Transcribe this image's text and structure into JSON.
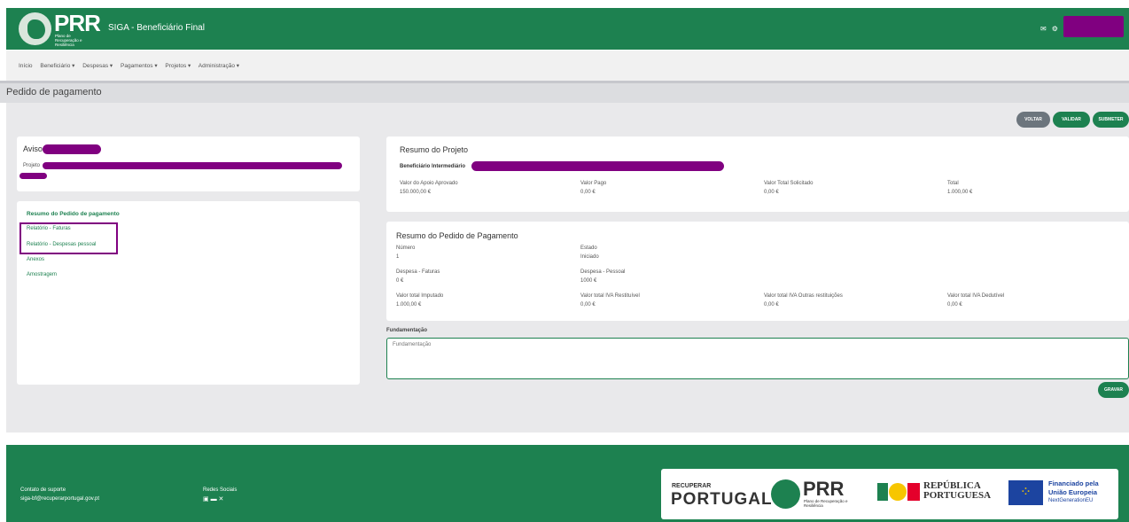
{
  "header": {
    "logo_text": "PRR",
    "logo_subtitle": "Plano de Recuperação e Resiliência",
    "app_title": "SIGA - Beneficiário Final"
  },
  "nav": {
    "items": [
      "Início",
      "Beneficiário ▾",
      "Despesas ▾",
      "Pagamentos ▾",
      "Projetos ▾",
      "Administração ▾"
    ]
  },
  "page": {
    "title": "Pedido de pagamento",
    "buttons": {
      "voltar": "VOLTAR",
      "validar": "VALIDAR",
      "submeter": "SUBMETER",
      "gravar": "GRAVAR"
    }
  },
  "aviso_card": {
    "title": "Aviso",
    "projeto_label": "Projeto"
  },
  "sidebar": {
    "title": "Resumo do Pedido de pagamento",
    "items": [
      "Relatório - Faturas",
      "Relatório - Despesas pessoal",
      "Anexos",
      "Amostragem"
    ]
  },
  "resumo_projeto": {
    "title": "Resumo do Projeto",
    "beneficiario_label": "Beneficiário Intermediário",
    "fields": [
      {
        "label": "Valor do Apoio Aprovado",
        "value": "150.000,00 €"
      },
      {
        "label": "Valor Pago",
        "value": "0,00 €"
      },
      {
        "label": "Valor Total Solicitado",
        "value": "0,00 €"
      },
      {
        "label": "Total",
        "value": "1.000,00 €"
      }
    ]
  },
  "resumo_pedido": {
    "title": "Resumo do Pedido de Pagamento",
    "numero": {
      "label": "Número",
      "value": "1"
    },
    "estado": {
      "label": "Estado",
      "value": "Iniciado"
    },
    "despesa_faturas": {
      "label": "Despesa - Faturas",
      "value": "0 €"
    },
    "despesa_pessoal": {
      "label": "Despesa - Pessoal",
      "value": "1000 €"
    },
    "iva": [
      {
        "label": "Valor total Imputado",
        "value": "1.000,00 €"
      },
      {
        "label": "Valor total IVA Restituível",
        "value": "0,00 €"
      },
      {
        "label": "Valor total IVA Outras restituições",
        "value": "0,00 €"
      },
      {
        "label": "Valor total IVA Dedutível",
        "value": "0,00 €"
      }
    ]
  },
  "fundamentacao": {
    "label": "Fundamentação",
    "placeholder": "Fundamentação"
  },
  "footer": {
    "contact_label": "Contato de suporte",
    "contact_email": "siga-bf@recuperarportugal.gov.pt",
    "social_label": "Redes Sociais",
    "logo_recuperar_small": "RECUPERAR",
    "logo_portugal": "PORTUGAL",
    "logo_prr": "PRR",
    "logo_prr_sub": "Plano de Recuperação e Resiliência",
    "republica": "REPÚBLICA PORTUGUESA",
    "eu_line1": "Financiado pela",
    "eu_line2": "União Europeia",
    "eu_line3": "NextGenerationEU"
  },
  "colors": {
    "brand": "#1d8150",
    "redaction": "#800080",
    "highlight_border": "#800080"
  }
}
